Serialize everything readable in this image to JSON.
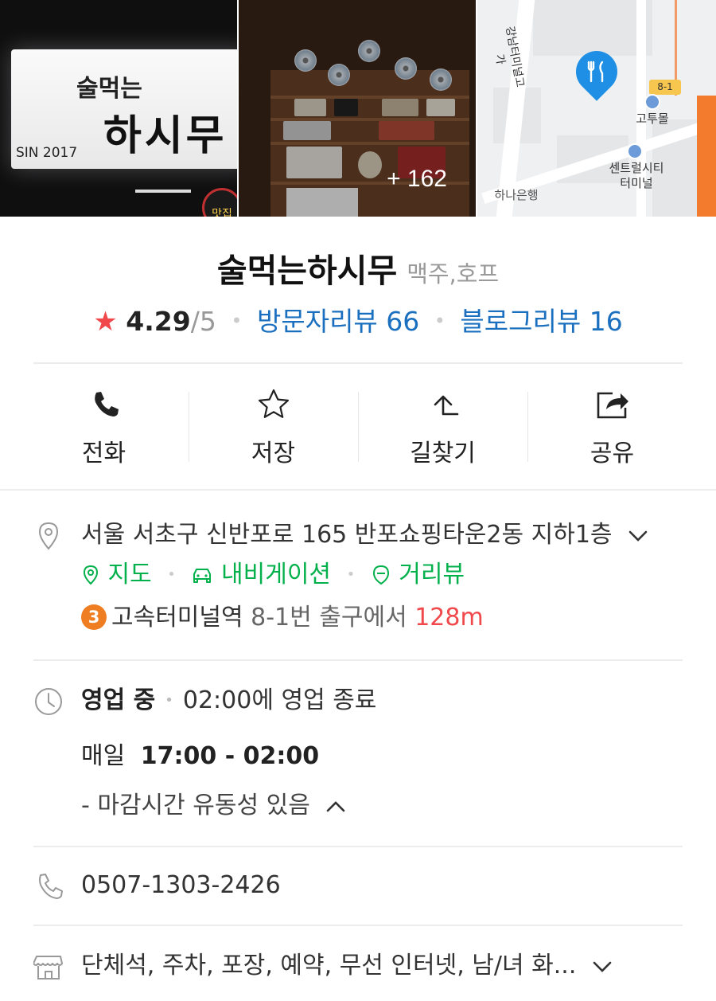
{
  "photos": {
    "sign_top": "술먹는",
    "sign_main": "하시무",
    "sign_year": "SIN 2017",
    "sign_badge": "맛집",
    "more_count": "+ 162",
    "map_labels": {
      "road": "강남터미널고가",
      "gotomall": "고투몰",
      "central_city": "센트럴시티\n터미널",
      "hana_bank": "하나은행",
      "exit": "8-1"
    }
  },
  "place": {
    "name": "술먹는하시무",
    "category": "맥주,호프",
    "rating": "4.29",
    "rating_max": "/5",
    "visitor_reviews": "방문자리뷰 66",
    "blog_reviews": "블로그리뷰 16"
  },
  "actions": [
    {
      "label": "전화",
      "icon": "phone-icon"
    },
    {
      "label": "저장",
      "icon": "star-icon"
    },
    {
      "label": "길찾기",
      "icon": "directions-icon"
    },
    {
      "label": "공유",
      "icon": "share-icon"
    }
  ],
  "address": {
    "text": "서울 서초구 신반포로 165 반포쇼핑타운2동 지하1층",
    "map_link": "지도",
    "navigation_link": "내비게이션",
    "street_view_link": "거리뷰",
    "subway_line": "3",
    "subway_station": "고속터미널역",
    "subway_exit": " 8-1번 출구에서 ",
    "subway_distance": "128m"
  },
  "hours": {
    "status": "영업 중",
    "closing_text": "02:00에 영업 종료",
    "days": "매일",
    "time_range": "17:00 - 02:00",
    "note": "- 마감시간 유동성 있음"
  },
  "phone": {
    "number": "0507-1303-2426"
  },
  "amenities": {
    "text": "단체석, 주차, 포장, 예약, 무선 인터넷, 남/녀 화..."
  },
  "colors": {
    "accent_blue": "#1b6fbf",
    "green": "#03b14c",
    "star_red": "#f0484b",
    "subway_orange": "#ef7d22",
    "pin_blue": "#1f8fe5"
  }
}
